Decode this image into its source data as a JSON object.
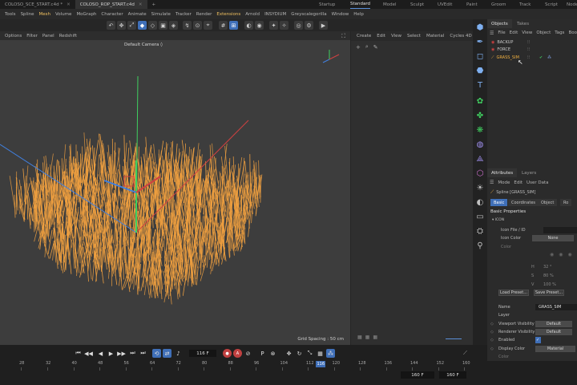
{
  "titlebar": {
    "doc_tabs": [
      {
        "label": "COLOSO_SCE_START.c4d *",
        "active": false
      },
      {
        "label": "COLOSO_ROP_START.c4d",
        "active": true
      }
    ],
    "add_tab": "+",
    "layouts": [
      "Startup",
      "Standard",
      "Model",
      "Sculpt",
      "UVEdit",
      "Paint",
      "Groom",
      "Track",
      "Script",
      "Nodes"
    ],
    "active_layout": "Standard"
  },
  "menubar": {
    "items": [
      "Tools",
      "Spline",
      "Mesh",
      "Volume",
      "MoGraph",
      "Character",
      "Animate",
      "Simulate",
      "Tracker",
      "Render",
      "Extensions",
      "Arnold",
      "INSYDIUM",
      "Greyscalegorilla",
      "Window",
      "Help"
    ],
    "highlight": [
      "Mesh",
      "Extensions"
    ]
  },
  "viewport": {
    "menus": [
      "Options",
      "Filter",
      "Panel",
      "Redshift"
    ],
    "camera_label": "Default Camera ◊",
    "grid_spacing": "Grid Spacing : 50 cm",
    "grass_color": "#f0a040",
    "background_color": "#3d3d3d"
  },
  "middle_panel": {
    "menus": [
      "Create",
      "Edit",
      "View",
      "Select",
      "Material",
      "Cycles 4D"
    ]
  },
  "objects_panel": {
    "tabs": [
      "Objects",
      "Takes"
    ],
    "menus": [
      "File",
      "Edit",
      "View",
      "Object",
      "Tags",
      "Boo"
    ],
    "objects": [
      {
        "name": "BACKUP",
        "selected": false,
        "color": "#d04040"
      },
      {
        "name": "FORCE",
        "selected": false,
        "color": "#d04040"
      },
      {
        "name": "GRASS_SIM",
        "selected": true,
        "color": "#f0b040"
      }
    ]
  },
  "attributes": {
    "tabs": [
      "Attributes",
      "Layers"
    ],
    "menus": [
      "Mode",
      "Edit",
      "User Data"
    ],
    "object_line": "Spline [GRASS_SIM]",
    "subtabs": [
      "Basic",
      "Coordinates",
      "Object",
      "Ro"
    ],
    "section": "Basic Properties",
    "icon_group": "ICON",
    "icon_file_label": "Icon File / ID",
    "icon_color_label": "Icon Color",
    "icon_color_value": "None",
    "color_label": "Color",
    "h_label": "H",
    "h_value": "32 °",
    "s_label": "S",
    "s_value": "80 %",
    "v_label": "V",
    "v_value": "100 %",
    "load_preset": "Load Preset...",
    "save_preset": "Save Preset...",
    "name_label": "Name",
    "name_value": "GRASS_SIM",
    "layer_label": "Layer",
    "viewport_vis_label": "Viewport Visibility",
    "viewport_vis_value": "Default",
    "renderer_vis_label": "Renderer Visibility",
    "renderer_vis_value": "Default",
    "enabled_label": "Enabled",
    "enabled_check": "✓",
    "display_color_label": "Display Color",
    "display_color_value": "Material",
    "color2_label": "Color"
  },
  "timeline": {
    "current_frame": "116 F",
    "end_frame_a": "160 F",
    "end_frame_b": "160 F",
    "ruler": [
      "28",
      "32",
      "40",
      "48",
      "56",
      "64",
      "72",
      "80",
      "88",
      "96",
      "104",
      "112",
      "120",
      "128",
      "136",
      "144",
      "152",
      "160"
    ],
    "playhead_label": "116"
  },
  "colors": {
    "accent": "#3f6fb8",
    "selected": "#f0b040",
    "record": "#c04040"
  }
}
